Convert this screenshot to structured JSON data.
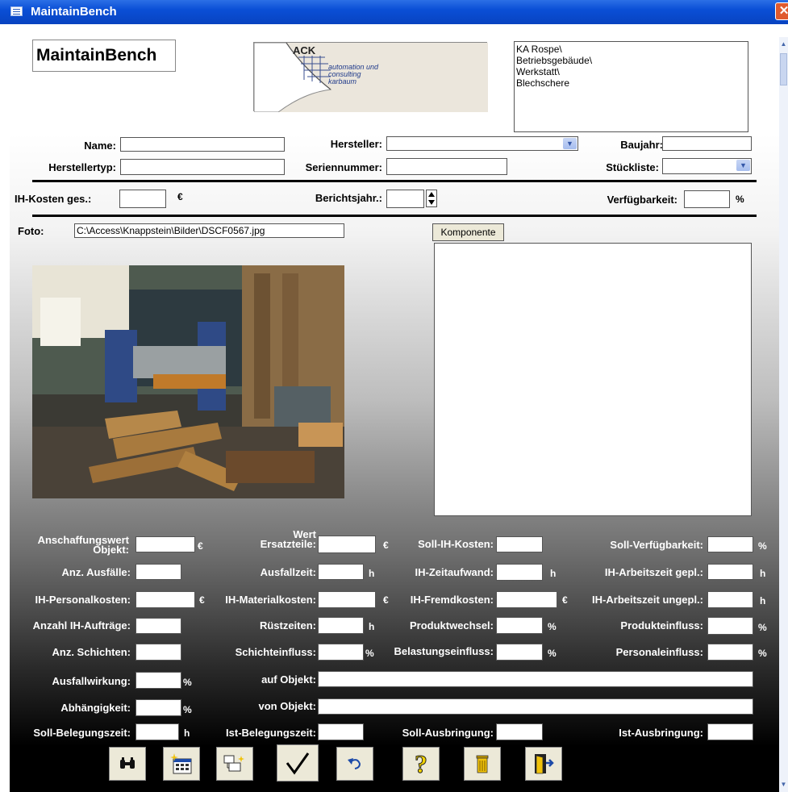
{
  "window": {
    "title": "MaintainBench"
  },
  "header": {
    "app_title": "MaintainBench",
    "logo": {
      "brand": "ACK",
      "line1": "automation und",
      "line2": "consulting",
      "line3": "karbaum"
    },
    "path_lines": [
      "KA Rospe\\",
      "Betriebsgebäude\\",
      "Werkstatt\\",
      "Blechschere"
    ]
  },
  "top_fields": {
    "name_label": "Name:",
    "hersteller_label": "Hersteller:",
    "baujahr_label": "Baujahr:",
    "herstellertyp_label": "Herstellertyp:",
    "seriennummer_label": "Seriennummer:",
    "stueckliste_label": "Stückliste:",
    "ih_kosten_label": "IH-Kosten ges.:",
    "berichtsjahr_label": "Berichtsjahr.:",
    "verfuegbarkeit_label": "Verfügbarkeit:",
    "euro": "€",
    "percent": "%"
  },
  "photo": {
    "label": "Foto:",
    "path": "C:\\Access\\Knappstein\\Bilder\\DSCF0567.jpg",
    "komponente_button": "Komponente"
  },
  "metrics": {
    "anschaffungswert_l1": "Anschaffungswert",
    "anschaffungswert_l2": "Objekt:",
    "wert_l1": "Wert",
    "wert_l2": "Ersatzteile:",
    "soll_ih_kosten": "Soll-IH-Kosten:",
    "soll_verfuegbarkeit": "Soll-Verfügbarkeit:",
    "anz_ausfaelle": "Anz. Ausfälle:",
    "ausfallzeit": "Ausfallzeit:",
    "ih_zeitaufwand": "IH-Zeitaufwand:",
    "ih_arbeitszeit_gepl": "IH-Arbeitszeit gepl.:",
    "ih_personalkosten": "IH-Personalkosten:",
    "ih_materialkosten": "IH-Materialkosten:",
    "ih_fremdkosten": "IH-Fremdkosten:",
    "ih_arbeitszeit_ungepl": "IH-Arbeitszeit ungepl.:",
    "anzahl_ih_auftraege": "Anzahl IH-Aufträge:",
    "ruestzeiten": "Rüstzeiten:",
    "produktwechsel": "Produktwechsel:",
    "produkteinfluss": "Produkteinfluss:",
    "anz_schichten": "Anz. Schichten:",
    "schichteinfluss": "Schichteinfluss:",
    "belastungseinfluss": "Belastungseinfluss:",
    "personaleinfluss": "Personaleinfluss:",
    "ausfallwirkung": "Ausfallwirkung:",
    "auf_objekt": "auf Objekt:",
    "abhaengigkeit": "Abhängigkeit:",
    "von_objekt": "von Objekt:",
    "soll_belegungszeit": "Soll-Belegungszeit:",
    "ist_belegungszeit": "Ist-Belegungszeit:",
    "soll_ausbringung": "Soll-Ausbringung:",
    "ist_ausbringung": "Ist-Ausbringung:",
    "unit_euro": "€",
    "unit_h": "h",
    "unit_pct": "%"
  },
  "toolbar": {
    "icons": [
      "binoculars-icon",
      "new-record-icon",
      "form-design-icon",
      "checkmark-icon",
      "undo-icon",
      "help-icon",
      "delete-icon",
      "exit-icon"
    ],
    "help_glyph": "?"
  },
  "colors": {
    "title_bar": "#0a4fd6",
    "close_button": "#e05a2e",
    "form_bg": "#000000",
    "button_face": "#ece9d8"
  }
}
